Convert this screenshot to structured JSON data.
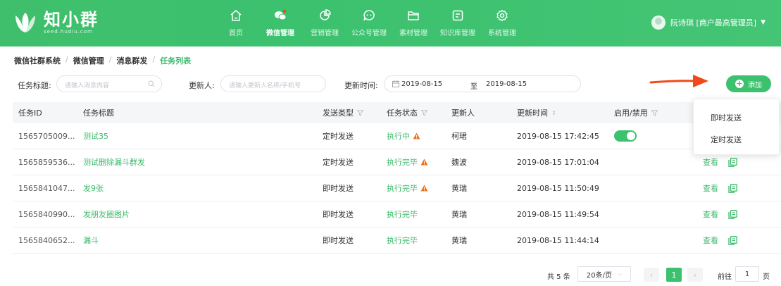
{
  "brand": {
    "name": "知小群",
    "sub": "seed.hudiu.com"
  },
  "nav": [
    {
      "label": "首页",
      "icon": "home-icon"
    },
    {
      "label": "微信管理",
      "icon": "wechat-icon",
      "active": true
    },
    {
      "label": "营销管理",
      "icon": "marketing-icon"
    },
    {
      "label": "公众号管理",
      "icon": "official-account-icon"
    },
    {
      "label": "素材管理",
      "icon": "folder-icon"
    },
    {
      "label": "知识库管理",
      "icon": "knowledge-icon"
    },
    {
      "label": "系统管理",
      "icon": "gear-icon"
    }
  ],
  "user": {
    "name": "阮诗琪 [商户最高管理员]"
  },
  "breadcrumb": [
    "微信社群系统",
    "微信管理",
    "消息群发",
    "任务列表"
  ],
  "filters": {
    "title_label": "任务标题:",
    "title_placeholder": "请输入消息内容",
    "updater_label": "更新人:",
    "updater_placeholder": "请输入更新人名称/手机号",
    "time_label": "更新时间:",
    "date_from": "2019-08-15",
    "date_sep": "至",
    "date_to": "2019-08-15"
  },
  "add_button": "添加",
  "dropdown": [
    "即时发送",
    "定时发送"
  ],
  "columns": [
    "任务ID",
    "任务标题",
    "发送类型",
    "任务状态",
    "更新人",
    "更新时间",
    "启用/禁用"
  ],
  "rows": [
    {
      "id": "1565705009...",
      "title": "测试35",
      "type": "定时发送",
      "status": "执行中",
      "warn": true,
      "updater": "柯珺",
      "time": "2019-08-15 17:42:45",
      "toggle": true
    },
    {
      "id": "1565859536...",
      "title": "测试删除漏斗群发",
      "type": "定时发送",
      "status": "执行完毕",
      "warn": true,
      "updater": "魏波",
      "time": "2019-08-15 17:01:04",
      "toggle": false
    },
    {
      "id": "1565841047...",
      "title": "发9张",
      "type": "即时发送",
      "status": "执行完毕",
      "warn": true,
      "updater": "黄瑞",
      "time": "2019-08-15 11:50:49",
      "toggle": false
    },
    {
      "id": "1565840990...",
      "title": "发朋友圈图片",
      "type": "即时发送",
      "status": "执行完毕",
      "warn": false,
      "updater": "黄瑞",
      "time": "2019-08-15 11:49:54",
      "toggle": false
    },
    {
      "id": "1565840652...",
      "title": "漏斗",
      "type": "即时发送",
      "status": "执行完毕",
      "warn": false,
      "updater": "黄瑞",
      "time": "2019-08-15 11:44:14",
      "toggle": false
    }
  ],
  "row_action": "查看",
  "pagination": {
    "total": "共 5 条",
    "page_size": "20条/页",
    "current": "1",
    "goto_label": "前往",
    "goto_value": "1",
    "page_unit": "页"
  },
  "colors": {
    "brand_green": "#3cc16e",
    "text_green": "#3cba6b",
    "warn_orange": "#f2711c",
    "arrow_red": "#f04a1a"
  }
}
